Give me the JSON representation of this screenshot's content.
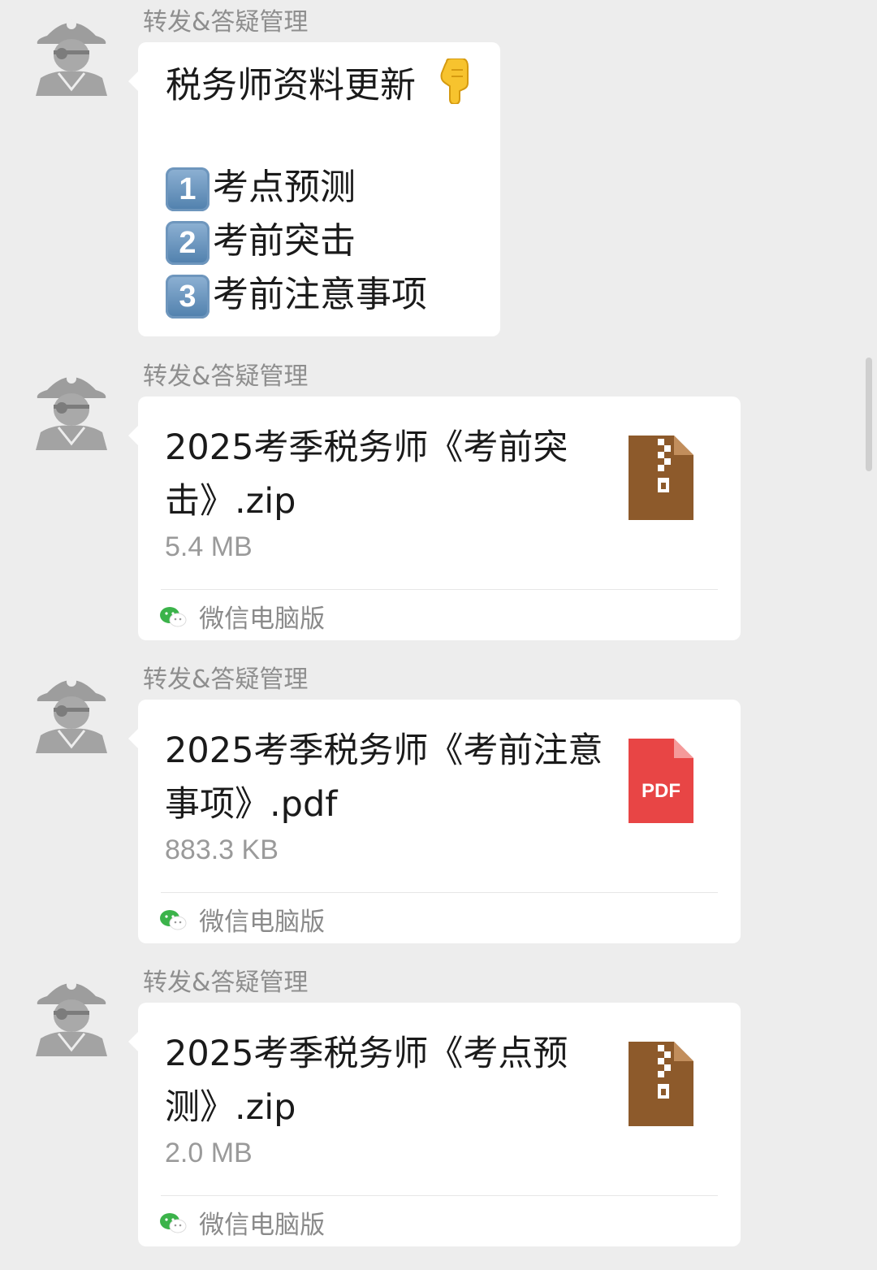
{
  "theme": {
    "background": "#ededed",
    "bubble": "#ffffff",
    "zip_color": "#8d5a2b",
    "pdf_color": "#e84545",
    "wechat_green": "#3bb34a"
  },
  "messages": [
    {
      "type": "text",
      "sender": "转发&答疑管理",
      "title": "税务师资料更新",
      "title_icon": "hand-pointing-down-icon",
      "items": [
        {
          "num": "1",
          "text": "考点预测"
        },
        {
          "num": "2",
          "text": "考前突击"
        },
        {
          "num": "3",
          "text": "考前注意事项"
        }
      ]
    },
    {
      "type": "file",
      "sender": "转发&答疑管理",
      "file_name": "2025考季税务师《考前突击》.zip",
      "file_size": "5.4 MB",
      "file_icon": "zip-file-icon",
      "source": "微信电脑版"
    },
    {
      "type": "file",
      "sender": "转发&答疑管理",
      "file_name": "2025考季税务师《考前注意事项》.pdf",
      "file_size": "883.3 KB",
      "file_icon": "pdf-file-icon",
      "file_icon_text": "PDF",
      "source": "微信电脑版"
    },
    {
      "type": "file",
      "sender": "转发&答疑管理",
      "file_name": "2025考季税务师《考点预测》.zip",
      "file_size": "2.0 MB",
      "file_icon": "zip-file-icon",
      "source": "微信电脑版"
    }
  ]
}
